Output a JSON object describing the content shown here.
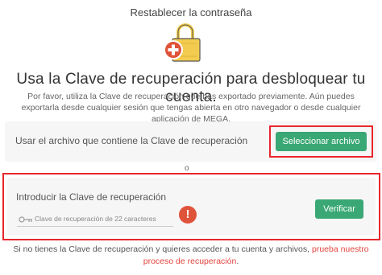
{
  "page": {
    "title": "Restablecer la contraseña",
    "headline": "Usa la Clave de recuperación para desbloquear tu cuenta.",
    "description": "Por favor, utiliza la Clave de recuperación que has exportado previamente. Aún puedes exportarla desde cualquier sesión que tengas abierta en otro navegador o desde cualquier aplicación de MEGA."
  },
  "file_option": {
    "label": "Usar el archivo que contiene la Clave de recuperación",
    "button_label": "Seleccionar archivo"
  },
  "separator": "o",
  "manual_option": {
    "label": "Introducir la Clave de recuperación",
    "input_placeholder": "Clave de recuperación de 22 caracteres",
    "warning_symbol": "!",
    "button_label": "Verificar"
  },
  "footer": {
    "text": "Si no tienes la Clave de recuperación y quieres acceder a tu cuenta y archivos, ",
    "link_label": "prueba nuestro proceso de recuperación",
    "end": "."
  },
  "colors": {
    "accent_green": "#3aa874",
    "highlight_red": "#e8262c",
    "warning": "#e0533b",
    "link": "#e5443e",
    "lock_yellow": "#f3cc4f"
  },
  "icons": {
    "lock": "lock-with-plus-icon",
    "key": "key-icon",
    "warning": "exclamation-icon"
  }
}
